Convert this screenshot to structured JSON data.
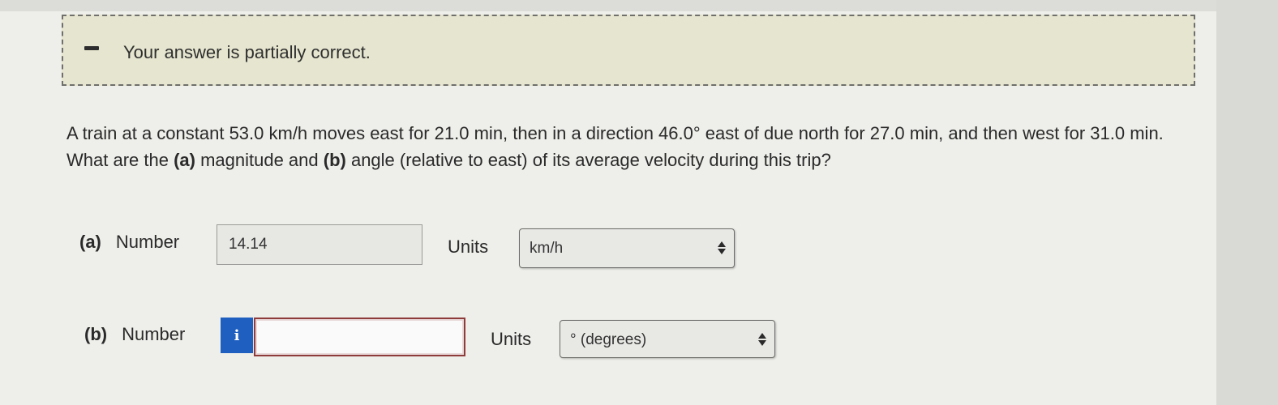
{
  "feedback": {
    "message": "Your answer is partially correct.",
    "icon": "minus-icon"
  },
  "question": {
    "line1_text": "A train at a constant 53.0 km/h moves east for 21.0 min, then in a direction 46.0° east of due north for 27.0 min, and then west for 31.0 min. What are the ",
    "part_a_tag": "(a)",
    "between": " magnitude and ",
    "part_b_tag": "(b)",
    "ending": " angle (relative to east) of its average velocity during this trip?"
  },
  "part_a": {
    "tag": "(a)",
    "label": "Number",
    "value": "14.14",
    "units_label": "Units",
    "units_selected": "km/h"
  },
  "part_b": {
    "tag": "(b)",
    "label": "Number",
    "info_icon_text": "i",
    "value": "",
    "units_label": "Units",
    "units_selected": "° (degrees)"
  },
  "colors": {
    "feedback_bg": "#e6e5cf",
    "info_button": "#1f5fbf",
    "error_border": "#8e3b3b"
  }
}
